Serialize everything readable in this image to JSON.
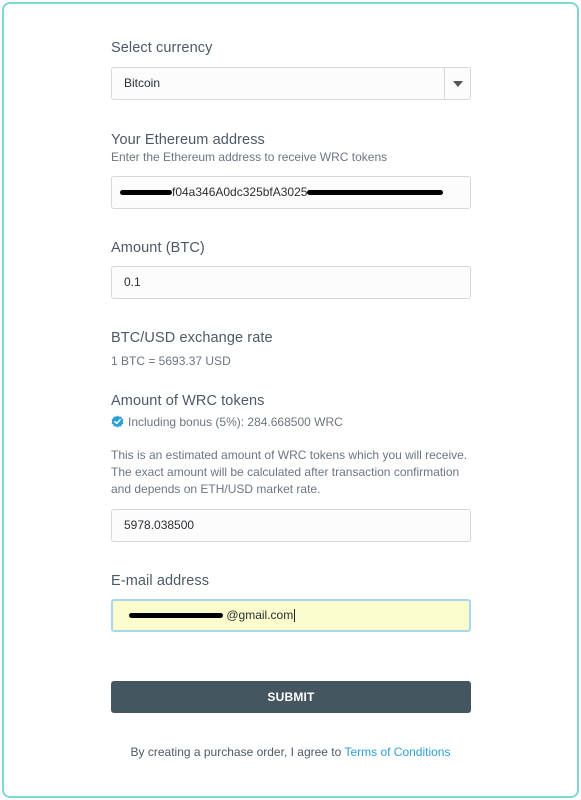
{
  "currency": {
    "label": "Select currency",
    "selected": "Bitcoin",
    "icon": "chevron-down-icon"
  },
  "ethereum": {
    "label": "Your Ethereum address",
    "hint": "Enter the Ethereum address to receive WRC tokens",
    "value_visible": "f04a346A0dc325bfA3025"
  },
  "amount": {
    "label": "Amount (BTC)",
    "value": "0.1"
  },
  "rate": {
    "label": "BTC/USD exchange rate",
    "value": "1 BTC = 5693.37 USD"
  },
  "tokens": {
    "label": "Amount of WRC tokens",
    "bonus": "Including bonus (5%): 284.668500 WRC",
    "note_line1": "This is an estimated amount of WRC tokens which you will receive.",
    "note_line2": "The exact amount will be calculated after transaction confirmation",
    "note_line3": "and depends on ETH/USD market rate.",
    "value": "5978.038500"
  },
  "email": {
    "label": "E-mail address",
    "value_visible": "@gmail.com"
  },
  "submit": {
    "label": "SUBMIT"
  },
  "footer": {
    "text": "By creating a purchase order, I agree to ",
    "link": "Terms of Conditions"
  },
  "colors": {
    "border": "#7fd8d8",
    "button": "#455660",
    "link": "#2a9fd6",
    "email_bg": "#fbfdcc",
    "check": "#2a9fd6"
  }
}
